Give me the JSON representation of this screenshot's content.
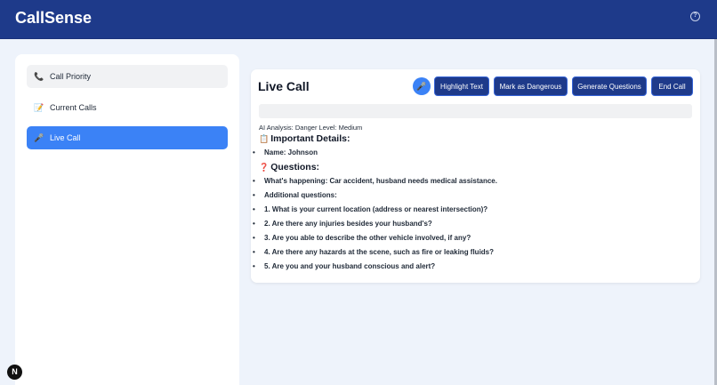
{
  "header": {
    "title": "CallSense",
    "help_icon": "question-circle-icon"
  },
  "sidebar": {
    "items": [
      {
        "label": "Call Priority",
        "icon": "phone-icon",
        "icon_glyph": "📞"
      },
      {
        "label": "Current Calls",
        "icon": "memo-icon",
        "icon_glyph": "📝"
      },
      {
        "label": "Live Call",
        "icon": "microphone-icon",
        "icon_glyph": "🎤",
        "active": true
      }
    ]
  },
  "main": {
    "title": "Live Call",
    "mic_glyph": "🎤",
    "buttons": {
      "highlight": "Highlight Text",
      "dangerous": "Mark as Dangerous",
      "generate": "Generate Questions",
      "end": "End Call"
    },
    "transcript_value": "",
    "analysis": "AI Analysis: Danger Level: Medium",
    "important_heading": "Important Details:",
    "important_emoji": "📋",
    "name_line": "Name: Johnson",
    "questions_heading": "Questions:",
    "questions_emoji": "❓",
    "items": [
      "What's happening: Car accident, husband needs medical assistance.",
      "Additional questions:",
      "1. What is your current location (address or nearest intersection)?",
      "2. Are there any injuries besides your husband's?",
      "3. Are you able to describe the other vehicle involved, if any?",
      "4. Are there any hazards at the scene, such as fire or leaking fluids?",
      "5. Are you and your husband conscious and alert?"
    ],
    "bullet": "•"
  },
  "colors": {
    "header_bg": "#1e3a8a",
    "accent": "#3b82f6",
    "button_bg": "#1e3a8a",
    "page_bg": "#eef3fb"
  },
  "fab_label": "N"
}
